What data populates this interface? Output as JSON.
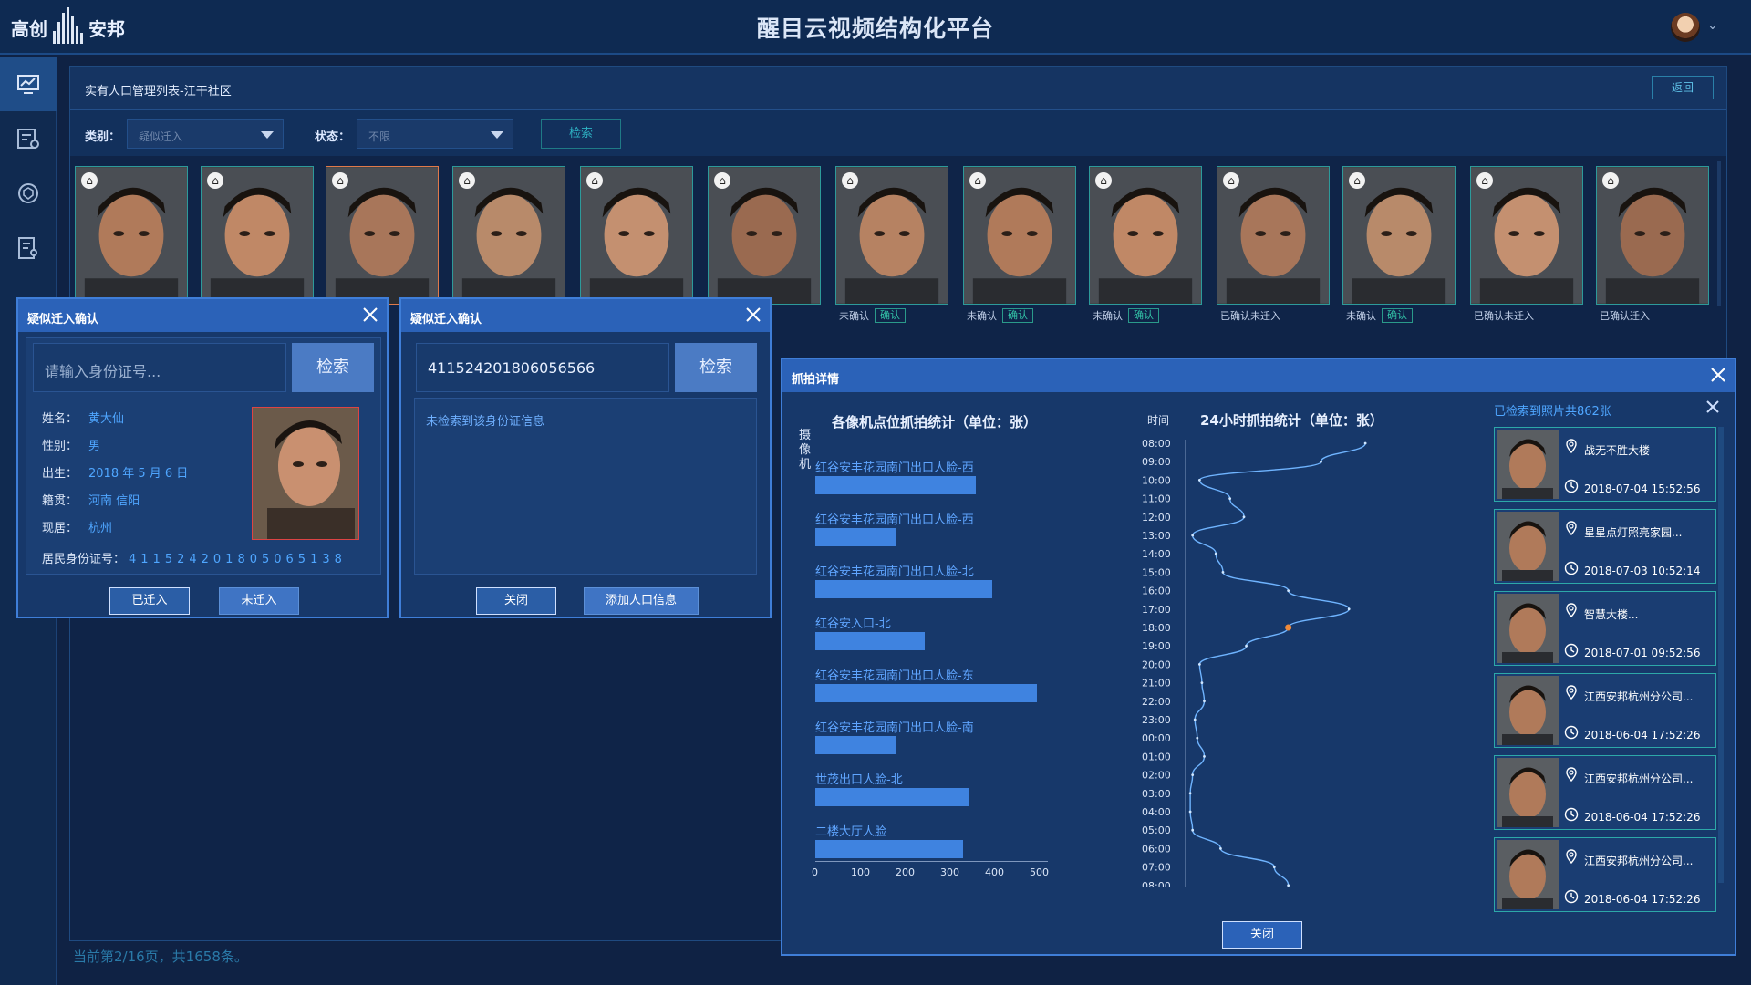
{
  "app": {
    "logo_left": "高创",
    "logo_right": "安邦",
    "title": "醒目云视频结构化平台"
  },
  "nav": [
    "monitor-icon",
    "list-settings-icon",
    "shield-icon",
    "report-icon"
  ],
  "panel": {
    "title": "实有人口管理列表-江干社区",
    "back_label": "返回",
    "filter": {
      "type_label": "类别：",
      "type_value": "疑似迁入",
      "status_label": "状态：",
      "status_value": "不限",
      "search_label": "检索"
    },
    "faces": [
      {
        "status": "",
        "confirm": ""
      },
      {
        "status": "",
        "confirm": ""
      },
      {
        "status": "",
        "confirm": ""
      },
      {
        "status": "",
        "confirm": ""
      },
      {
        "status": "",
        "confirm": ""
      },
      {
        "status": "",
        "confirm": ""
      },
      {
        "status": "未确认",
        "confirm": "确认"
      },
      {
        "status": "未确认",
        "confirm": "确认"
      },
      {
        "status": "未确认",
        "confirm": "确认"
      },
      {
        "status": "已确认未迁入",
        "confirm": ""
      },
      {
        "status": "未确认",
        "confirm": "确认"
      },
      {
        "status": "已确认未迁入",
        "confirm": ""
      },
      {
        "status": "已确认迁入",
        "confirm": ""
      }
    ],
    "footer": "当前第2/16页，共1658条。"
  },
  "dialog1": {
    "title": "疑似迁入确认",
    "input_placeholder": "请输入身份证号...",
    "search_label": "检索",
    "name_label": "姓名：",
    "name_value": "黄大仙",
    "gender_label": "性别：",
    "gender_value": "男",
    "birth_label": "出生：",
    "birth_value": "2018 年 5 月 6 日",
    "origin_label": "籍贯：",
    "origin_value": "河南 信阳",
    "residence_label": "现居：",
    "residence_value": "杭州",
    "id_label": "居民身份证号：",
    "id_value": "411524201805065138",
    "btn_moved": "已迁入",
    "btn_not_moved": "未迁入"
  },
  "dialog2": {
    "title": "疑似迁入确认",
    "input_value": "411524201806056566",
    "search_label": "检索",
    "not_found": "未检索到该身份证信息",
    "btn_close": "关闭",
    "btn_add": "添加人口信息"
  },
  "detail": {
    "title": "抓拍详情",
    "close_label": "关闭",
    "list_header": "已检索到照片共862张",
    "captures": [
      {
        "location": "战无不胜大楼",
        "time": "2018-07-04  15:52:56"
      },
      {
        "location": "星星点灯照亮家园...",
        "time": "2018-07-03  10:52:14"
      },
      {
        "location": "智慧大楼...",
        "time": "2018-07-01  09:52:56"
      },
      {
        "location": "江西安邦杭州分公司...",
        "time": "2018-06-04  17:52:26"
      },
      {
        "location": "江西安邦杭州分公司...",
        "time": "2018-06-04  17:52:26"
      },
      {
        "location": "江西安邦杭州分公司...",
        "time": "2018-06-04  17:52:26"
      }
    ]
  },
  "chart_data": [
    {
      "type": "bar",
      "orientation": "horizontal",
      "title": "各像机点位抓拍统计（单位：张）",
      "ylabel": "摄像机",
      "categories": [
        "红谷安丰花园南门出口人脸-西",
        "红谷安丰花园南门出口人脸-西",
        "红谷安丰花园南门出口人脸-北",
        "红谷安入口-北",
        "红谷安丰花园南门出口人脸-东",
        "红谷安丰花园南门出口人脸-南",
        "世茂出口人脸-北",
        "二楼大厅人脸"
      ],
      "values": [
        360,
        180,
        395,
        245,
        495,
        180,
        345,
        330
      ],
      "xlim": [
        0,
        500
      ],
      "xticks": [
        "0",
        "100",
        "200",
        "300",
        "400",
        "500"
      ]
    },
    {
      "type": "line",
      "title": "24小时抓拍统计（单位：张）",
      "ylabel": "时间",
      "y": [
        "08:00",
        "09:00",
        "10:00",
        "11:00",
        "12:00",
        "13:00",
        "14:00",
        "15:00",
        "16:00",
        "17:00",
        "18:00",
        "19:00",
        "20:00",
        "21:00",
        "22:00",
        "23:00",
        "00:00",
        "01:00",
        "02:00",
        "03:00",
        "04:00",
        "05:00",
        "06:00",
        "07:00",
        "08:00"
      ],
      "x": [
        385,
        290,
        30,
        95,
        125,
        15,
        65,
        80,
        220,
        350,
        220,
        130,
        30,
        35,
        40,
        20,
        25,
        40,
        15,
        10,
        10,
        15,
        75,
        190,
        220
      ],
      "highlight_index": 10,
      "xlim": [
        0,
        500
      ],
      "xticks": [
        "0",
        "100",
        "200",
        "300",
        "400",
        "500"
      ]
    }
  ]
}
